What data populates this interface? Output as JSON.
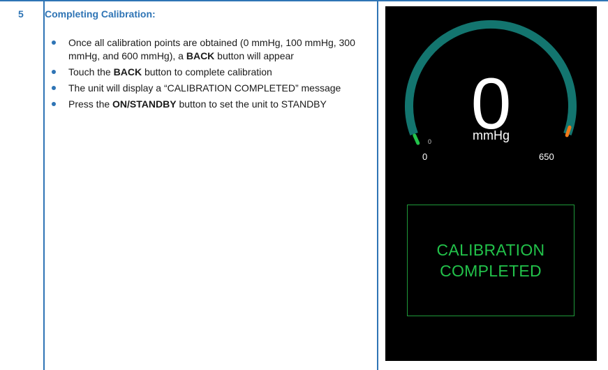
{
  "step": {
    "number": "5",
    "title": "Completing Calibration:"
  },
  "instructions": [
    [
      {
        "text": "Once all calibration points are obtained (0 mmHg, 100 mmHg, 300 mmHg, and 600 mmHg), a ",
        "bold": false
      },
      {
        "text": "BACK",
        "bold": true
      },
      {
        "text": " button will appear",
        "bold": false
      }
    ],
    [
      {
        "text": "Touch the ",
        "bold": false
      },
      {
        "text": "BACK",
        "bold": true
      },
      {
        "text": " button to complete calibration",
        "bold": false
      }
    ],
    [
      {
        "text": "The unit will display a “CALIBRATION COMPLETED” message",
        "bold": false
      }
    ],
    [
      {
        "text": "Press the ",
        "bold": false
      },
      {
        "text": "ON/STANDBY",
        "bold": true
      },
      {
        "text": " button to set the unit to STANDBY",
        "bold": false
      }
    ]
  ],
  "device_screen": {
    "reading": "0",
    "unit": "mmHg",
    "gauge": {
      "min": "0",
      "max": "650",
      "min_marker": "0",
      "value": 0
    },
    "status_line_1": "CALIBRATION",
    "status_line_2": "COMPLETED"
  },
  "colors": {
    "accent": "#2e74b5",
    "gauge_track": "#13756f",
    "gauge_start": "#22c24a",
    "gauge_end": "#f07a1a",
    "status_green": "#22c24a"
  }
}
